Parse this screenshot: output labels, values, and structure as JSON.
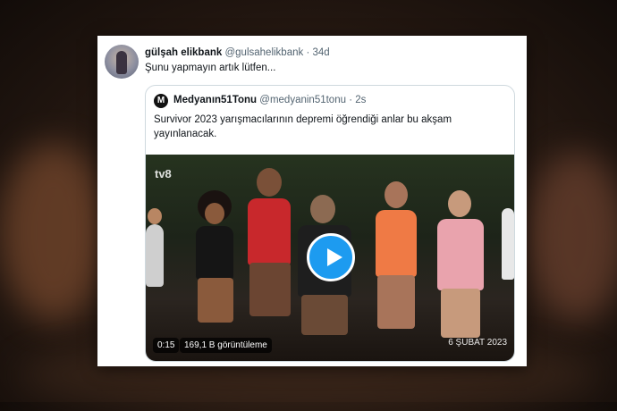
{
  "tweet": {
    "display_name": "gülşah elikbank",
    "handle": "@gulsahelikbank",
    "separator": "·",
    "time": "34d",
    "text": "Şunu yapmayın artık lütfen..."
  },
  "quoted": {
    "avatar_letter": "M",
    "display_name": "Medyanın51Tonu",
    "handle": "@medyanin51tonu",
    "separator": "·",
    "time": "2s",
    "text": "Survivor 2023 yarışmacılarının depremi öğrendiği anlar bu akşam yayınlanacak.",
    "video": {
      "channel_logo": "tv8",
      "duration": "0:15",
      "views": "169,1 B görüntüleme",
      "date_stamp": "6 ŞUBAT 2023",
      "play_icon": "play-icon"
    }
  },
  "colors": {
    "accent": "#1d9bf0",
    "text_primary": "#0f1419",
    "text_secondary": "#536471",
    "border": "#cfd9de"
  }
}
